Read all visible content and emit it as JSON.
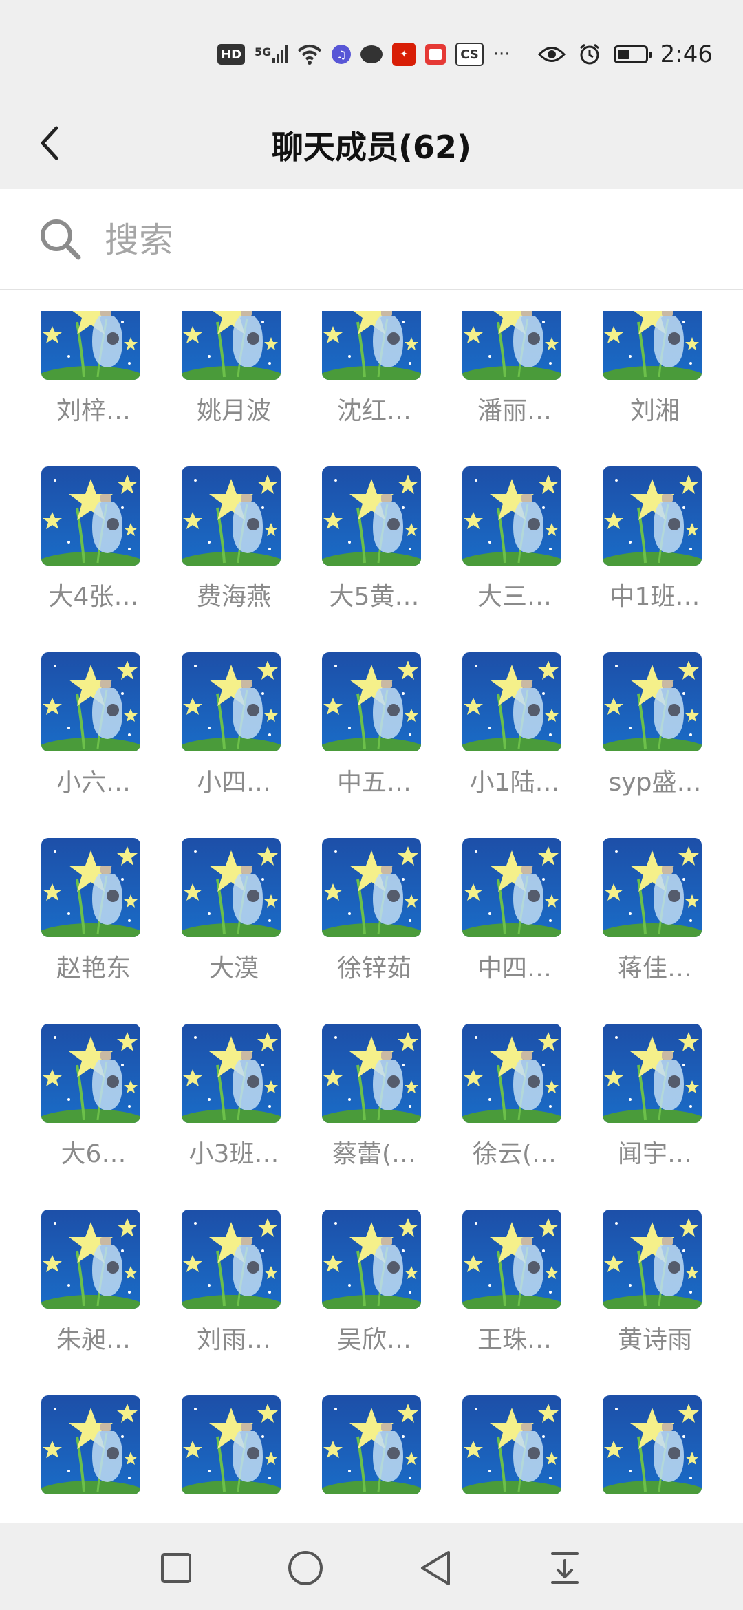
{
  "status_bar": {
    "hd_label": "HD",
    "signal_label": "5G",
    "cs_label": "CS",
    "more_label": "···",
    "time": "2:46",
    "battery_level": 0.45
  },
  "header": {
    "title": "聊天成员(62)",
    "back_icon": "chevron-left-icon"
  },
  "search": {
    "placeholder": "搜索",
    "icon": "search-icon"
  },
  "members": [
    {
      "name": "刘梓…"
    },
    {
      "name": "姚月波"
    },
    {
      "name": "沈红…"
    },
    {
      "name": "潘丽…"
    },
    {
      "name": "刘湘"
    },
    {
      "name": "大4张…"
    },
    {
      "name": "费海燕"
    },
    {
      "name": "大5黄…"
    },
    {
      "name": "大三…"
    },
    {
      "name": "中1班…"
    },
    {
      "name": "小六…"
    },
    {
      "name": "小四…"
    },
    {
      "name": "中五…"
    },
    {
      "name": "小1陆…"
    },
    {
      "name": "syp盛…"
    },
    {
      "name": "赵艳东"
    },
    {
      "name": "大漠"
    },
    {
      "name": "徐锌茹"
    },
    {
      "name": "中四…"
    },
    {
      "name": "蒋佳…"
    },
    {
      "name": "大6…"
    },
    {
      "name": "小3班…"
    },
    {
      "name": "蔡蕾(…"
    },
    {
      "name": "徐云(…"
    },
    {
      "name": "闻宇…"
    },
    {
      "name": "朱昶…"
    },
    {
      "name": "刘雨…"
    },
    {
      "name": "吴欣…"
    },
    {
      "name": "王珠…"
    },
    {
      "name": "黄诗雨"
    },
    {
      "name": ""
    },
    {
      "name": ""
    },
    {
      "name": ""
    },
    {
      "name": ""
    },
    {
      "name": ""
    }
  ],
  "nav_bar": {
    "icons": [
      "square-icon",
      "circle-home-icon",
      "triangle-back-icon",
      "download-tray-icon"
    ]
  }
}
